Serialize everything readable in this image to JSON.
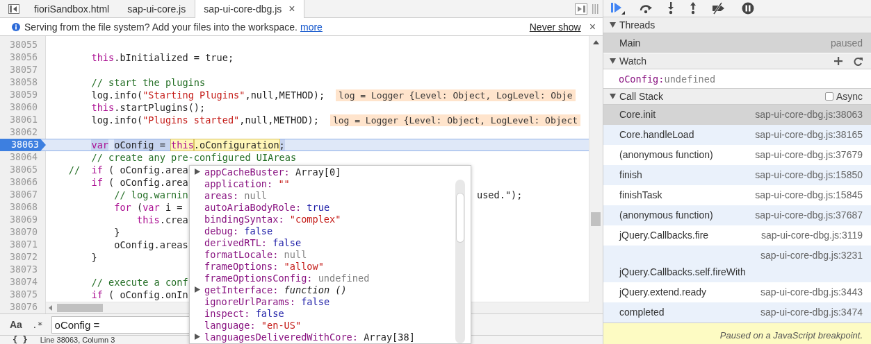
{
  "editor": {
    "tabs": [
      {
        "label": "fioriSandbox.html",
        "selected": false
      },
      {
        "label": "sap-ui-core.js",
        "selected": false
      },
      {
        "label": "sap-ui-core-dbg.js",
        "selected": true,
        "close": "×"
      }
    ],
    "info_bar": {
      "message": "Serving from the file system? Add your files into the workspace.",
      "link": "more",
      "dismiss": "Never show",
      "close": "×"
    },
    "code": {
      "lines": [
        {
          "number": "38055",
          "current": false
        },
        {
          "number": "38056",
          "current": false,
          "tokens": [
            {
              "kind": "keyword",
              "text": "        this"
            },
            {
              "kind": "plain",
              "text": ".bInitialized = true;"
            }
          ]
        },
        {
          "number": "38057",
          "current": false
        },
        {
          "number": "38058",
          "current": false,
          "tokens": [
            {
              "kind": "comment",
              "text": "        // start the plugins"
            }
          ]
        },
        {
          "number": "38059",
          "current": false,
          "tokens": [
            {
              "kind": "plain",
              "text": "        log.info("
            },
            {
              "kind": "string",
              "text": "\"Starting Plugins\""
            },
            {
              "kind": "plain",
              "text": ",null,METHOD);"
            }
          ],
          "annotation": "log = Logger {Level: Object, LogLevel: Obje"
        },
        {
          "number": "38060",
          "current": false,
          "tokens": [
            {
              "kind": "keyword",
              "text": "        this"
            },
            {
              "kind": "plain",
              "text": ".startPlugins();"
            }
          ]
        },
        {
          "number": "38061",
          "current": false,
          "tokens": [
            {
              "kind": "plain",
              "text": "        log.info("
            },
            {
              "kind": "string",
              "text": "\"Plugins started\""
            },
            {
              "kind": "plain",
              "text": ",null,METHOD);"
            }
          ],
          "annotation": "log = Logger {Level: Object, LogLevel: Object"
        },
        {
          "number": "38062",
          "current": false
        },
        {
          "number": "38063",
          "current": true,
          "tokens": [
            {
              "kind": "keyword",
              "text": "        var",
              "selected": true,
              "evaluated": false
            },
            {
              "kind": "plain",
              "text": " oConfig = ",
              "selected": true,
              "evaluated": false
            },
            {
              "kind": "keyword",
              "text": "this",
              "selected": false,
              "evaluated": true
            },
            {
              "kind": "plain",
              "text": ".oConfiguration",
              "selected": false,
              "evaluated": true
            },
            {
              "kind": "plain",
              "text": ";",
              "selected": true,
              "evaluated": false
            }
          ]
        },
        {
          "number": "38064",
          "current": false,
          "tokens": [
            {
              "kind": "comment",
              "text": "        // create any pre-configured UIAreas"
            }
          ]
        },
        {
          "number": "38065",
          "current": false,
          "tokens": [
            {
              "kind": "comment",
              "text": "    //"
            },
            {
              "kind": "keyword",
              "text": "  if"
            },
            {
              "kind": "plain",
              "text": " ( oConfig.area"
            }
          ]
        },
        {
          "number": "38066",
          "current": false,
          "tokens": [
            {
              "kind": "keyword",
              "text": "        if"
            },
            {
              "kind": "plain",
              "text": " ( oConfig.area"
            }
          ]
        },
        {
          "number": "38067",
          "current": false,
          "tokens": [
            {
              "kind": "comment",
              "text": "            // log.warnin"
            }
          ],
          "tail": "used.\");"
        },
        {
          "number": "38068",
          "current": false,
          "tokens": [
            {
              "kind": "keyword",
              "text": "            for"
            },
            {
              "kind": "plain",
              "text": " ("
            },
            {
              "kind": "keyword",
              "text": "var"
            },
            {
              "kind": "plain",
              "text": " i ="
            }
          ]
        },
        {
          "number": "38069",
          "current": false,
          "tokens": [
            {
              "kind": "keyword",
              "text": "                this"
            },
            {
              "kind": "plain",
              "text": ".crea"
            }
          ]
        },
        {
          "number": "38070",
          "current": false,
          "tokens": [
            {
              "kind": "plain",
              "text": "            }"
            }
          ]
        },
        {
          "number": "38071",
          "current": false,
          "tokens": [
            {
              "kind": "plain",
              "text": "            oConfig.areas"
            }
          ]
        },
        {
          "number": "38072",
          "current": false,
          "tokens": [
            {
              "kind": "plain",
              "text": "        }"
            }
          ]
        },
        {
          "number": "38073",
          "current": false
        },
        {
          "number": "38074",
          "current": false,
          "tokens": [
            {
              "kind": "comment",
              "text": "        // execute a conf"
            }
          ]
        },
        {
          "number": "38075",
          "current": false,
          "tokens": [
            {
              "kind": "keyword",
              "text": "        if"
            },
            {
              "kind": "plain",
              "text": " ( oConfig.onIn"
            }
          ]
        },
        {
          "number": "38076",
          "current": false
        }
      ]
    },
    "popover": {
      "properties": [
        {
          "name": "appCacheBuster:",
          "value": "Array[0]",
          "kind": "object",
          "expandable": true
        },
        {
          "name": "application:",
          "value": "\"\"",
          "kind": "string",
          "expandable": false
        },
        {
          "name": "areas:",
          "value": "null",
          "kind": "null",
          "expandable": false
        },
        {
          "name": "autoAriaBodyRole:",
          "value": "true",
          "kind": "boolean",
          "expandable": false
        },
        {
          "name": "bindingSyntax:",
          "value": "\"complex\"",
          "kind": "string",
          "expandable": false
        },
        {
          "name": "debug:",
          "value": "false",
          "kind": "boolean",
          "expandable": false
        },
        {
          "name": "derivedRTL:",
          "value": "false",
          "kind": "boolean",
          "expandable": false
        },
        {
          "name": "formatLocale:",
          "value": "null",
          "kind": "null",
          "expandable": false
        },
        {
          "name": "frameOptions:",
          "value": "\"allow\"",
          "kind": "string",
          "expandable": false
        },
        {
          "name": "frameOptionsConfig:",
          "value": "undefined",
          "kind": "null",
          "expandable": false
        },
        {
          "name": "getInterface:",
          "value": "function ()",
          "kind": "function",
          "expandable": true
        },
        {
          "name": "ignoreUrlParams:",
          "value": "false",
          "kind": "boolean",
          "expandable": false
        },
        {
          "name": "inspect:",
          "value": "false",
          "kind": "boolean",
          "expandable": false
        },
        {
          "name": "language:",
          "value": "\"en-US\"",
          "kind": "string",
          "expandable": false
        },
        {
          "name": "languagesDeliveredWithCore:",
          "value": "Array[38]",
          "kind": "object",
          "expandable": true
        }
      ]
    },
    "search": {
      "case_toggle": "Aa",
      "regex_toggle": ".*",
      "value": "oConfig ="
    },
    "status": {
      "format_button": "{ }",
      "position": "Line 38063, Column 3"
    }
  },
  "sidebar": {
    "threads": {
      "title": "Threads",
      "expanded": true,
      "items": [
        {
          "name": "Main",
          "status": "paused",
          "selected": true
        }
      ]
    },
    "watch": {
      "title": "Watch",
      "expanded": true,
      "expressions": [
        {
          "name": "oConfig:",
          "value": "undefined"
        }
      ]
    },
    "call_stack": {
      "title": "Call Stack",
      "expanded": true,
      "async": {
        "label": "Async",
        "checked": false
      },
      "frames": [
        {
          "name": "Core.init",
          "location": "sap-ui-core-dbg.js:38063",
          "selected": true
        },
        {
          "name": "Core.handleLoad",
          "location": "sap-ui-core-dbg.js:38165",
          "selected": false
        },
        {
          "name": "(anonymous function)",
          "location": "sap-ui-core-dbg.js:37679",
          "selected": false
        },
        {
          "name": "finish",
          "location": "sap-ui-core-dbg.js:15850",
          "selected": false
        },
        {
          "name": "finishTask",
          "location": "sap-ui-core-dbg.js:15845",
          "selected": false
        },
        {
          "name": "(anonymous function)",
          "location": "sap-ui-core-dbg.js:37687",
          "selected": false
        },
        {
          "name": "jQuery.Callbacks.fire",
          "location": "sap-ui-core-dbg.js:3119",
          "selected": false
        },
        {
          "name": "jQuery.Callbacks.self.fireWith",
          "location": "sap-ui-core-dbg.js:3231",
          "selected": false
        },
        {
          "name": "jQuery.extend.ready",
          "location": "sap-ui-core-dbg.js:3443",
          "selected": false
        },
        {
          "name": "completed",
          "location": "sap-ui-core-dbg.js:3474",
          "selected": false
        }
      ]
    },
    "pause_message": "Paused on a JavaScript breakpoint."
  }
}
